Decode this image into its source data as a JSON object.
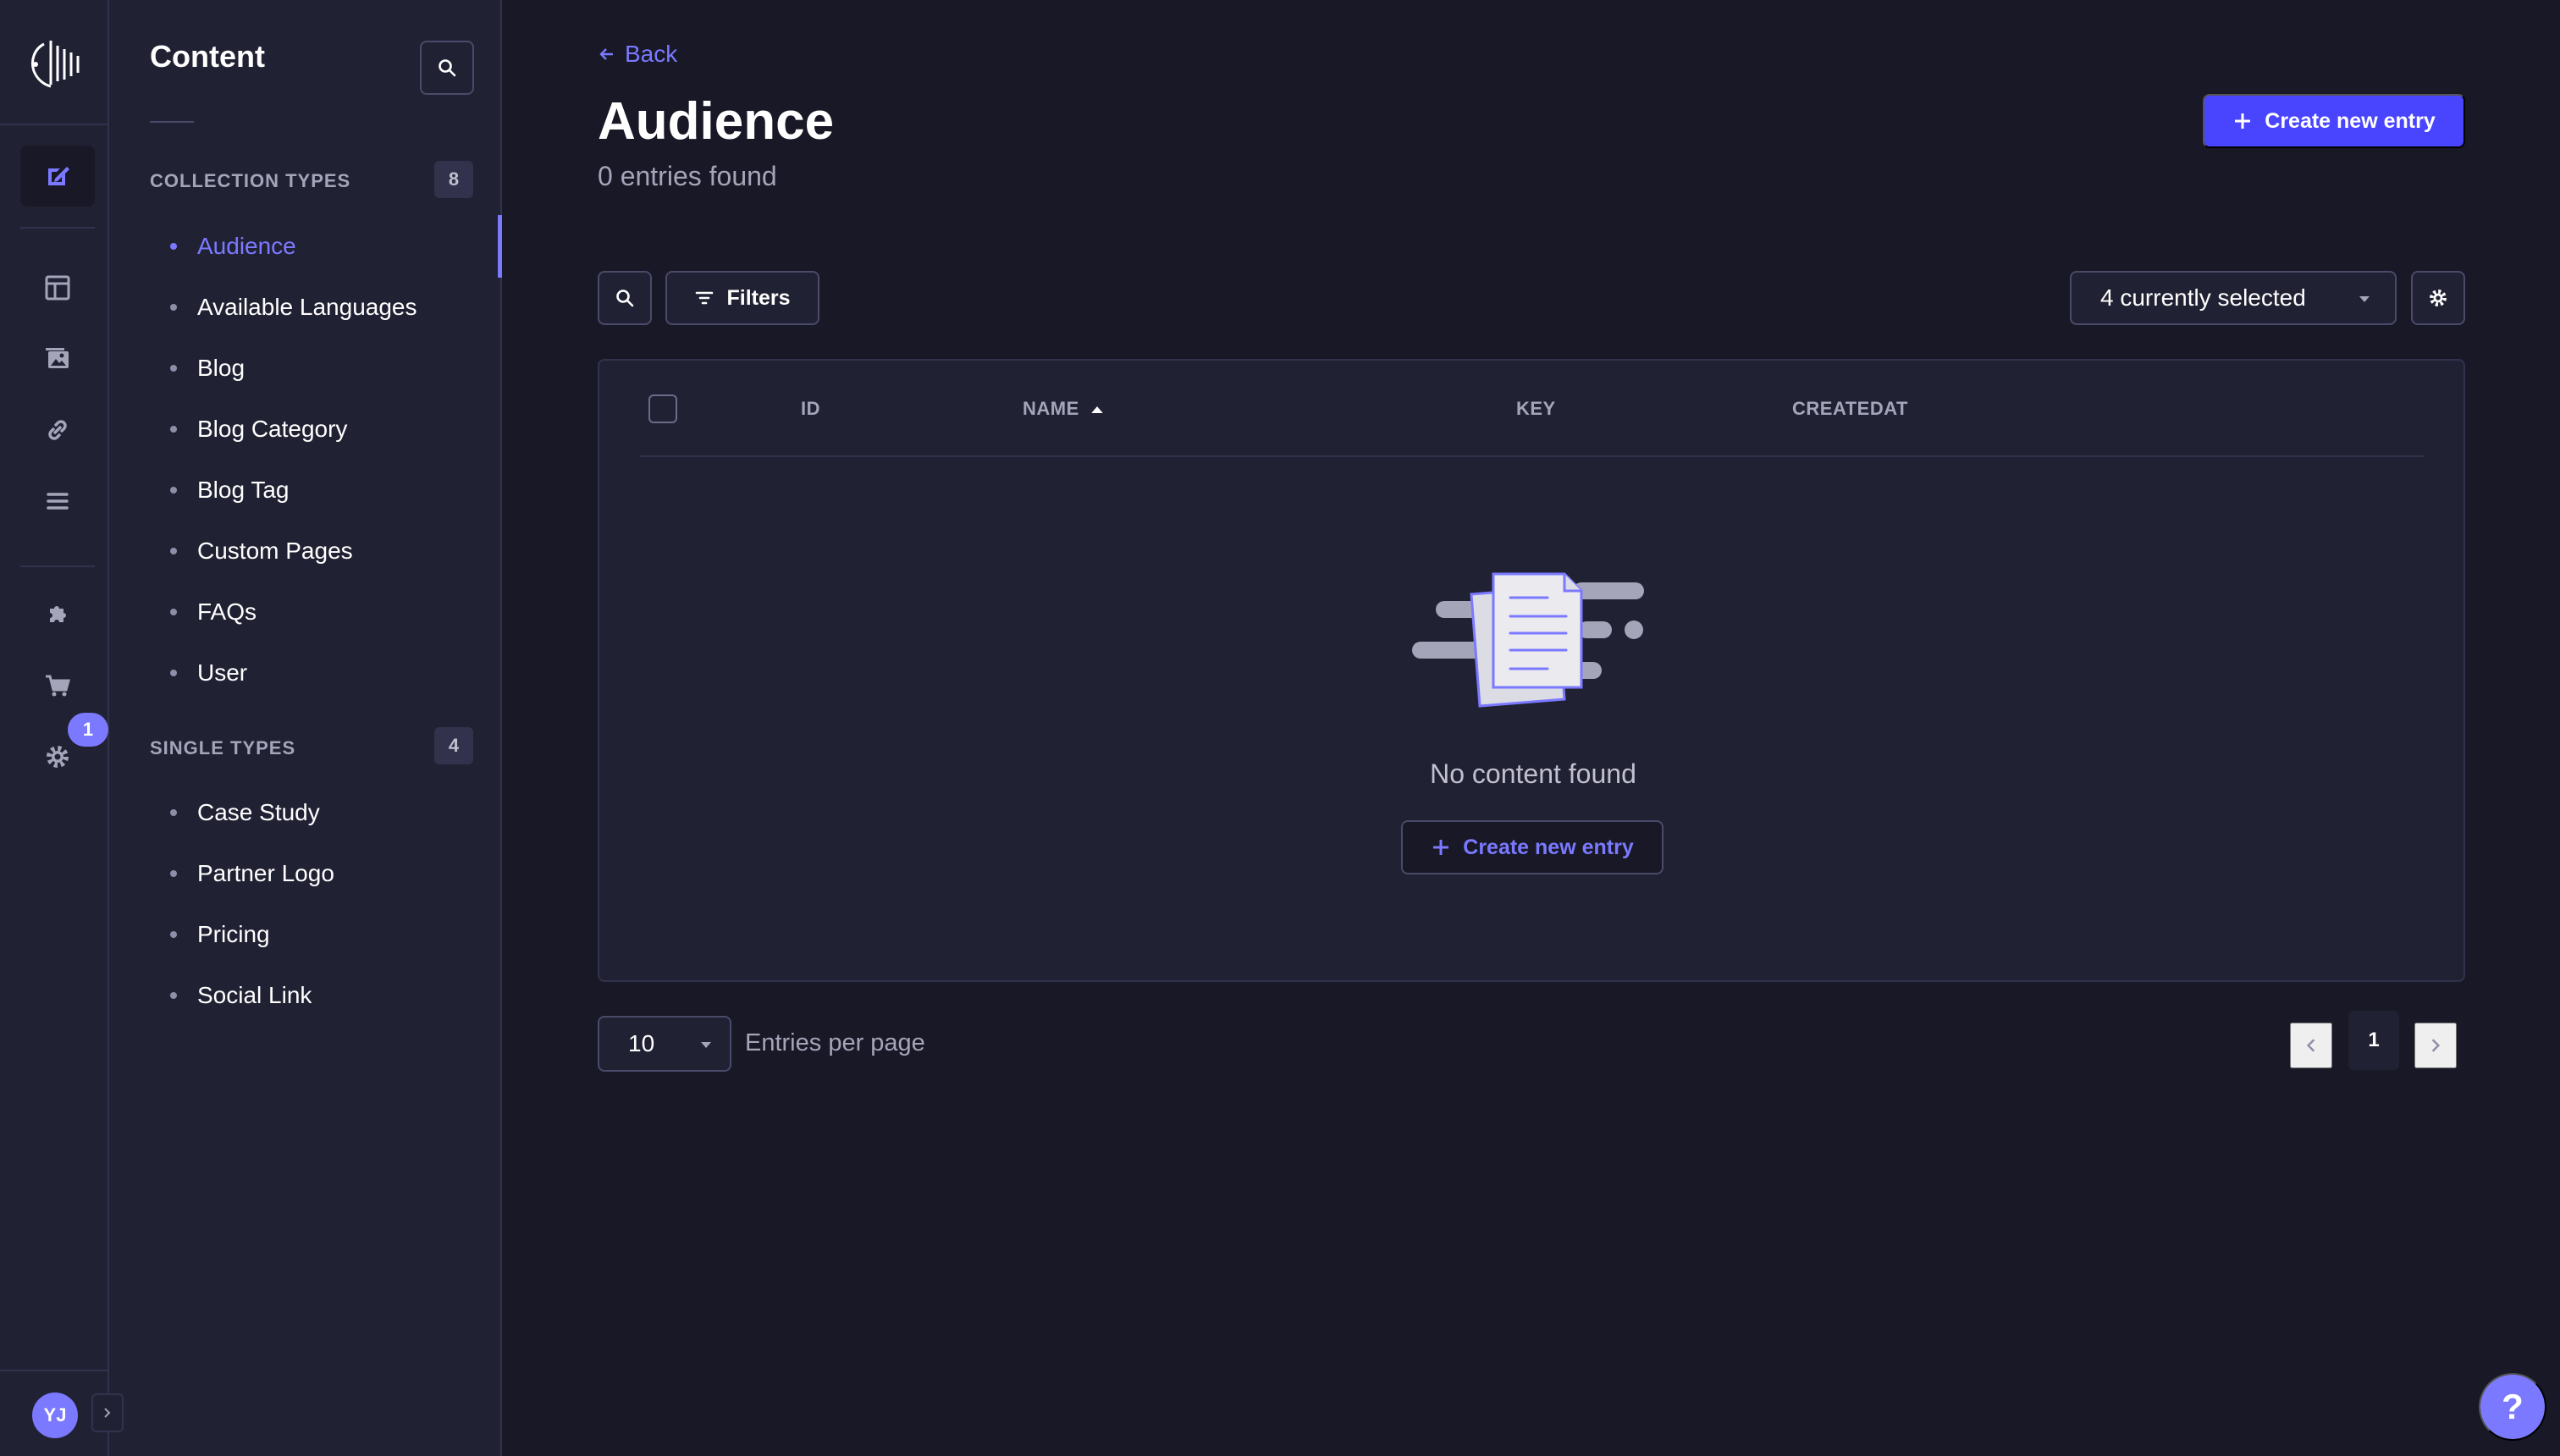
{
  "rail": {
    "nav": [
      {
        "name": "content-manager-icon",
        "active": true
      },
      {
        "name": "content-type-builder-icon",
        "active": false
      },
      {
        "name": "media-library-icon",
        "active": false
      },
      {
        "name": "link-icon",
        "active": false
      },
      {
        "name": "list-icon",
        "active": false
      },
      {
        "name": "plugins-icon",
        "active": false
      },
      {
        "name": "marketplace-icon",
        "active": false
      },
      {
        "name": "settings-icon",
        "active": false
      }
    ],
    "settings_badge": "1",
    "avatar_initials": "YJ"
  },
  "sidebar": {
    "title": "Content",
    "collection_types": {
      "label": "COLLECTION TYPES",
      "count": "8",
      "items": [
        "Audience",
        "Available Languages",
        "Blog",
        "Blog Category",
        "Blog Tag",
        "Custom Pages",
        "FAQs",
        "User"
      ],
      "active": "Audience"
    },
    "single_types": {
      "label": "SINGLE TYPES",
      "count": "4",
      "items": [
        "Case Study",
        "Partner Logo",
        "Pricing",
        "Social Link"
      ]
    }
  },
  "header": {
    "back_label": "Back",
    "title": "Audience",
    "subtitle": "0 entries found",
    "create_label": "Create new entry"
  },
  "toolbar": {
    "filters_label": "Filters",
    "columns_selected": "4 currently selected"
  },
  "table": {
    "columns": [
      "ID",
      "NAME",
      "KEY",
      "CREATEDAT"
    ],
    "sorted_column": "NAME",
    "sort_direction": "asc",
    "rows": [],
    "empty_text": "No content found",
    "empty_create_label": "Create new entry"
  },
  "pagination": {
    "page_size": "10",
    "page_size_label": "Entries per page",
    "current_page": "1"
  },
  "help": {
    "label": "?"
  },
  "colors": {
    "accent": "#4945ff",
    "accent_light": "#7b79ff",
    "background": "#181826",
    "panel": "#212134",
    "border": "#32324d"
  }
}
